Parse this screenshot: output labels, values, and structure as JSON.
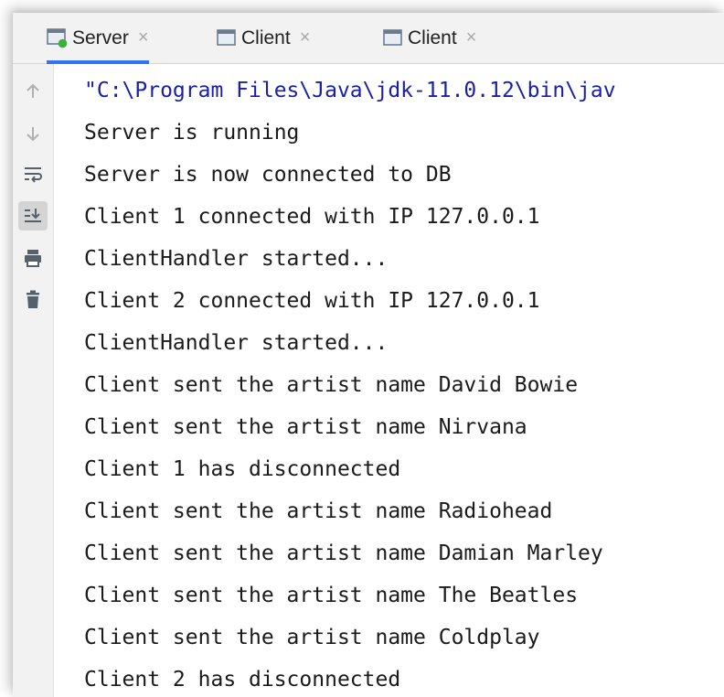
{
  "tabs": [
    {
      "label": "Server",
      "close": "×",
      "active": true
    },
    {
      "label": "Client",
      "close": "×",
      "active": false
    },
    {
      "label": "Client",
      "close": "×",
      "active": false
    }
  ],
  "toolbar": {
    "icons": [
      "arrow-up-icon",
      "arrow-down-icon",
      "soft-wrap-icon",
      "scroll-to-end-icon",
      "print-icon",
      "trash-icon"
    ]
  },
  "console": {
    "lines": [
      "\"C:\\Program Files\\Java\\jdk-11.0.12\\bin\\jav",
      "Server is running",
      "Server is now connected to DB",
      "Client 1 connected with IP 127.0.0.1",
      "ClientHandler started...",
      "Client 2 connected with IP 127.0.0.1",
      "ClientHandler started...",
      "Client sent the artist name David Bowie",
      "Client sent the artist name Nirvana",
      "Client 1 has disconnected",
      "Client sent the artist name Radiohead",
      "Client sent the artist name Damian Marley",
      "Client sent the artist name The Beatles",
      "Client sent the artist name Coldplay",
      "Client 2 has disconnected"
    ]
  },
  "colors": {
    "command_text": "#1a1fa8",
    "active_tab_underline": "#3574f0",
    "run_indicator": "#3fae3a"
  }
}
